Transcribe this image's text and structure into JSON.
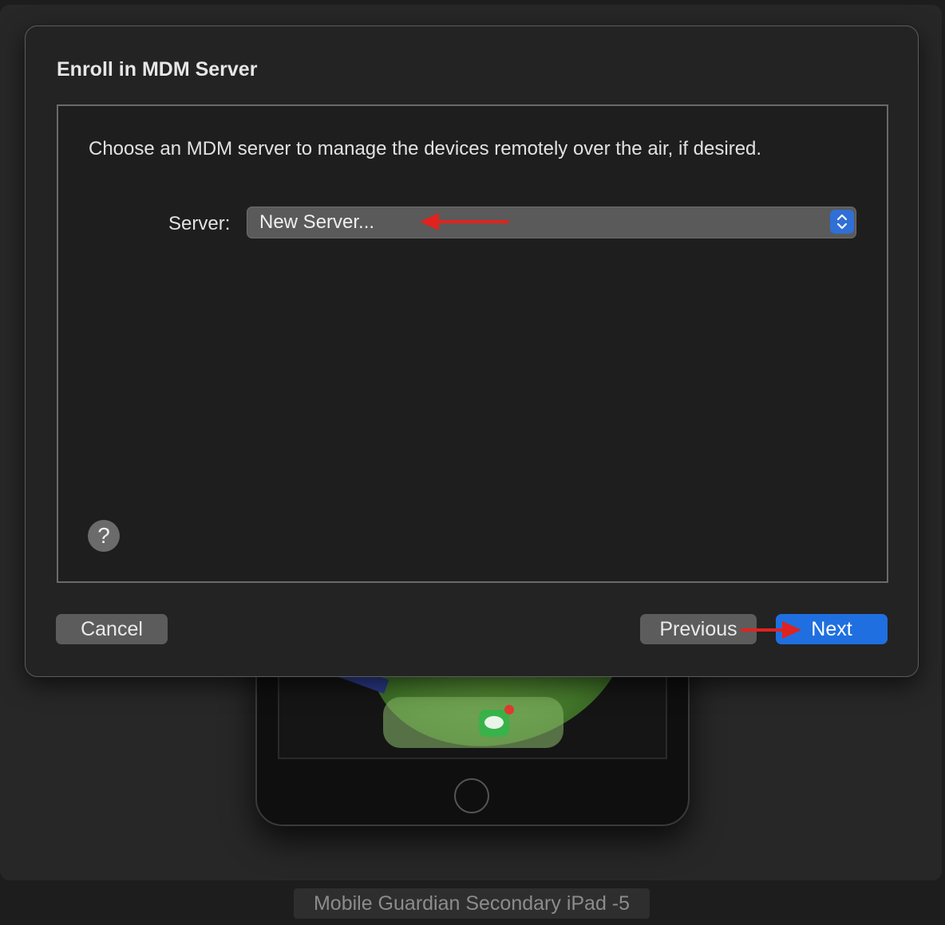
{
  "dialog": {
    "title": "Enroll in MDM Server",
    "description": "Choose an MDM server to manage the devices remotely over the air, if desired.",
    "server_label": "Server:",
    "server_value": "New Server...",
    "help_symbol": "?"
  },
  "buttons": {
    "cancel": "Cancel",
    "previous": "Previous",
    "next": "Next"
  },
  "device": {
    "label": "Mobile Guardian Secondary iPad -5"
  },
  "colors": {
    "accent": "#1f6fe0",
    "annotation_arrow": "#e0231e"
  }
}
